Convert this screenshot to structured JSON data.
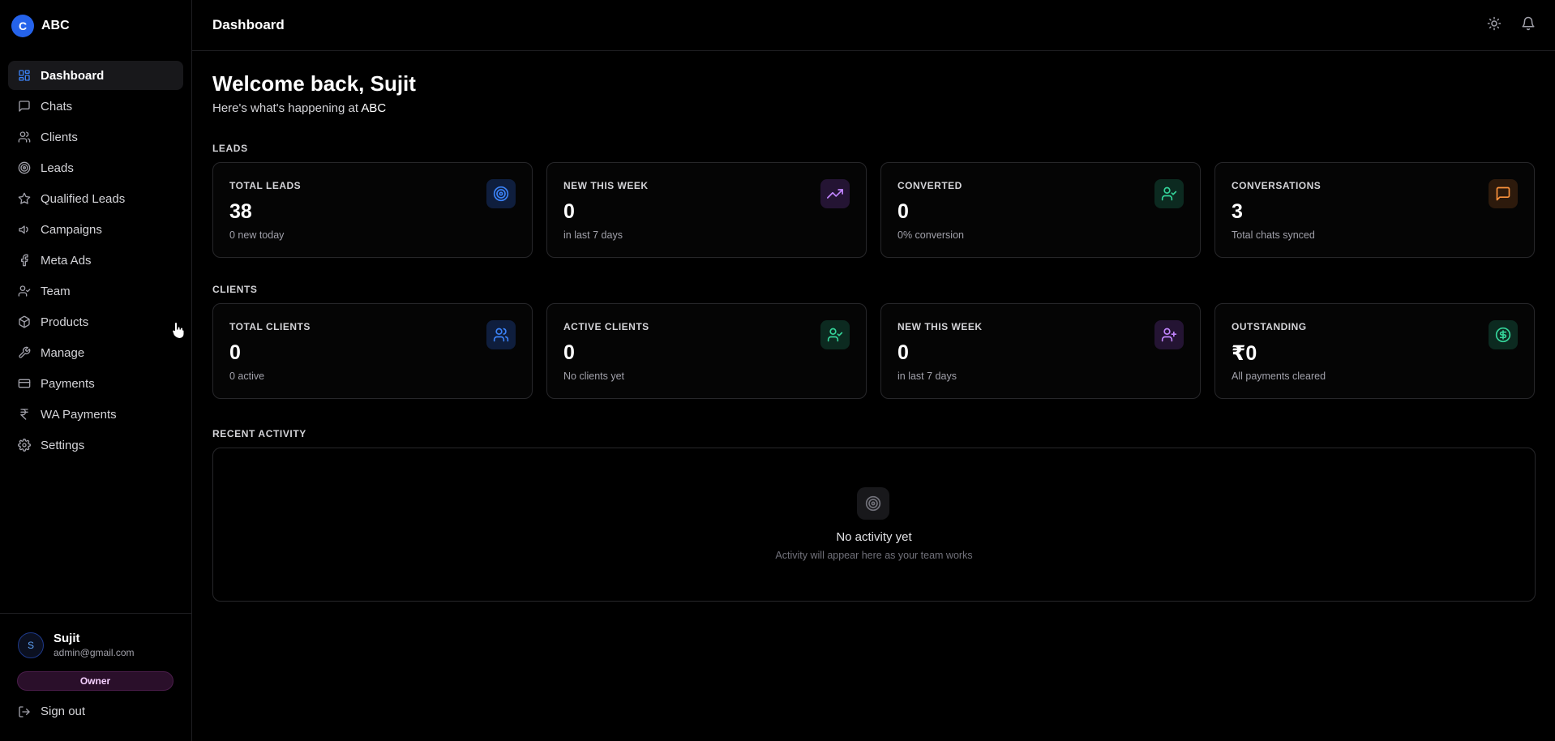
{
  "brand": {
    "logo_letter": "C",
    "name": "ABC",
    "logo_color": "#2563eb"
  },
  "sidebar": {
    "items": [
      {
        "label": "Dashboard",
        "icon": "layout-grid-icon",
        "active": true
      },
      {
        "label": "Chats",
        "icon": "message-square-icon"
      },
      {
        "label": "Clients",
        "icon": "users-icon"
      },
      {
        "label": "Leads",
        "icon": "target-icon"
      },
      {
        "label": "Qualified Leads",
        "icon": "star-icon"
      },
      {
        "label": "Campaigns",
        "icon": "megaphone-icon"
      },
      {
        "label": "Meta Ads",
        "icon": "facebook-icon"
      },
      {
        "label": "Team",
        "icon": "user-check-icon"
      },
      {
        "label": "Products",
        "icon": "package-icon"
      },
      {
        "label": "Manage",
        "icon": "wrench-icon"
      },
      {
        "label": "Payments",
        "icon": "credit-card-icon"
      },
      {
        "label": "WA Payments",
        "icon": "rupee-icon"
      },
      {
        "label": "Settings",
        "icon": "gear-icon"
      }
    ]
  },
  "user": {
    "initial": "S",
    "name": "Sujit",
    "email": "admin@gmail.com",
    "role": "Owner"
  },
  "signout_label": "Sign out",
  "header": {
    "title": "Dashboard"
  },
  "welcome": {
    "title": "Welcome back, Sujit",
    "sub_prefix": "Here's what's happening at",
    "org": "ABC"
  },
  "leads": {
    "label": "LEADS",
    "cards": [
      {
        "label": "TOTAL LEADS",
        "value": "38",
        "sub": "0 new today",
        "icon": "target-icon",
        "color": "#3b82f6",
        "bg": "#0f1e3d"
      },
      {
        "label": "NEW THIS WEEK",
        "value": "0",
        "sub": "in last 7 days",
        "icon": "trending-up-icon",
        "color": "#c084fc",
        "bg": "#241433"
      },
      {
        "label": "CONVERTED",
        "value": "0",
        "sub": "0% conversion",
        "icon": "user-check-icon",
        "color": "#34d399",
        "bg": "#0c2a20"
      },
      {
        "label": "CONVERSATIONS",
        "value": "3",
        "sub": "Total chats synced",
        "icon": "message-square-icon",
        "color": "#fb923c",
        "bg": "#2d1a0c"
      }
    ]
  },
  "clients": {
    "label": "CLIENTS",
    "cards": [
      {
        "label": "TOTAL CLIENTS",
        "value": "0",
        "sub": "0 active",
        "icon": "users-icon",
        "color": "#3b82f6",
        "bg": "#0f1e3d"
      },
      {
        "label": "ACTIVE CLIENTS",
        "value": "0",
        "sub": "No clients yet",
        "icon": "user-check-icon",
        "color": "#34d399",
        "bg": "#0c2a20"
      },
      {
        "label": "NEW THIS WEEK",
        "value": "0",
        "sub": "in last 7 days",
        "icon": "user-plus-icon",
        "color": "#c084fc",
        "bg": "#241433"
      },
      {
        "label": "OUTSTANDING",
        "value": "₹0",
        "sub": "All payments cleared",
        "icon": "dollar-circle-icon",
        "color": "#34d399",
        "bg": "#0c2a20"
      }
    ]
  },
  "activity": {
    "label": "RECENT ACTIVITY",
    "empty_title": "No activity yet",
    "empty_sub": "Activity will appear here as your team works"
  }
}
